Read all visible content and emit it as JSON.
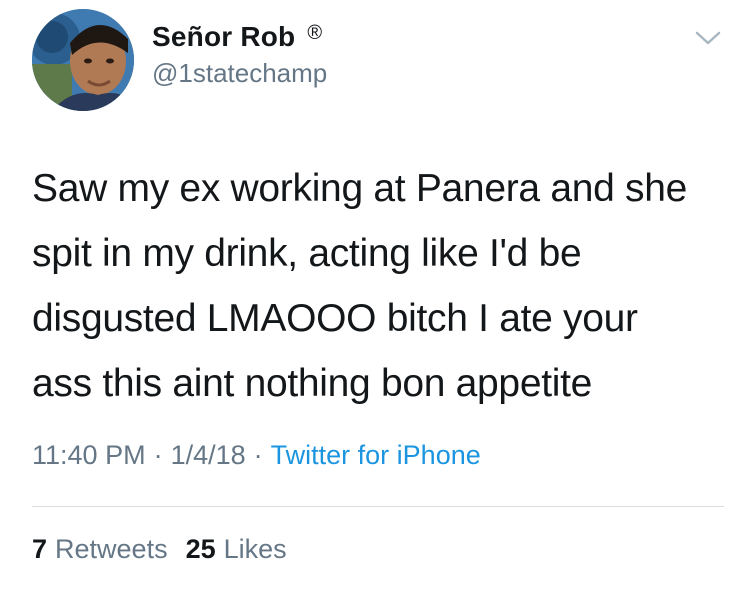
{
  "author": {
    "display_name": "Señor Rob",
    "verified_mark": "®",
    "handle": "@1statechamp",
    "avatar": "profile-photo",
    "menu_icon": "chevron-down-icon"
  },
  "tweet": {
    "lines": [
      "Saw my ex working at Panera and she",
      "spit in my drink, acting like I'd be",
      "disgusted LMAOOO bitch I ate your",
      "ass this aint nothing bon appetite"
    ],
    "time": "11:40 PM",
    "separator": "·",
    "date": "1/4/18",
    "source": "Twitter for iPhone"
  },
  "stats": {
    "retweets_count": "7",
    "retweets_label": "Retweets",
    "likes_count": "25",
    "likes_label": "Likes"
  },
  "colors": {
    "text": "#14171a",
    "secondary": "#657786",
    "link": "#1b95e0",
    "divider": "#d8dde2"
  }
}
